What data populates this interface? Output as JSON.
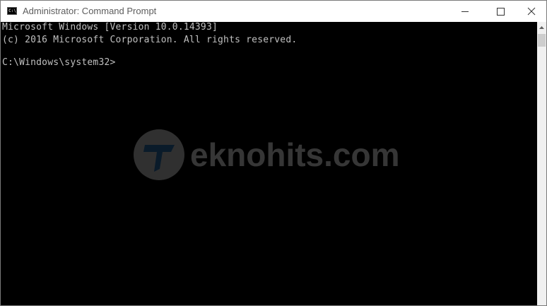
{
  "window": {
    "title": "Administrator: Command Prompt",
    "icon": "cmd-icon",
    "icon_text": "C:\\"
  },
  "controls": {
    "minimize": "minimize",
    "maximize": "maximize",
    "close": "close"
  },
  "console": {
    "lines": [
      "Microsoft Windows [Version 10.0.14393]",
      "(c) 2016 Microsoft Corporation. All rights reserved.",
      "C:\\Windows\\system32>"
    ],
    "text_color": "#c0c0c0",
    "background": "#000000"
  },
  "watermark": {
    "text": "eknohits.com",
    "logo_letter": "T"
  }
}
